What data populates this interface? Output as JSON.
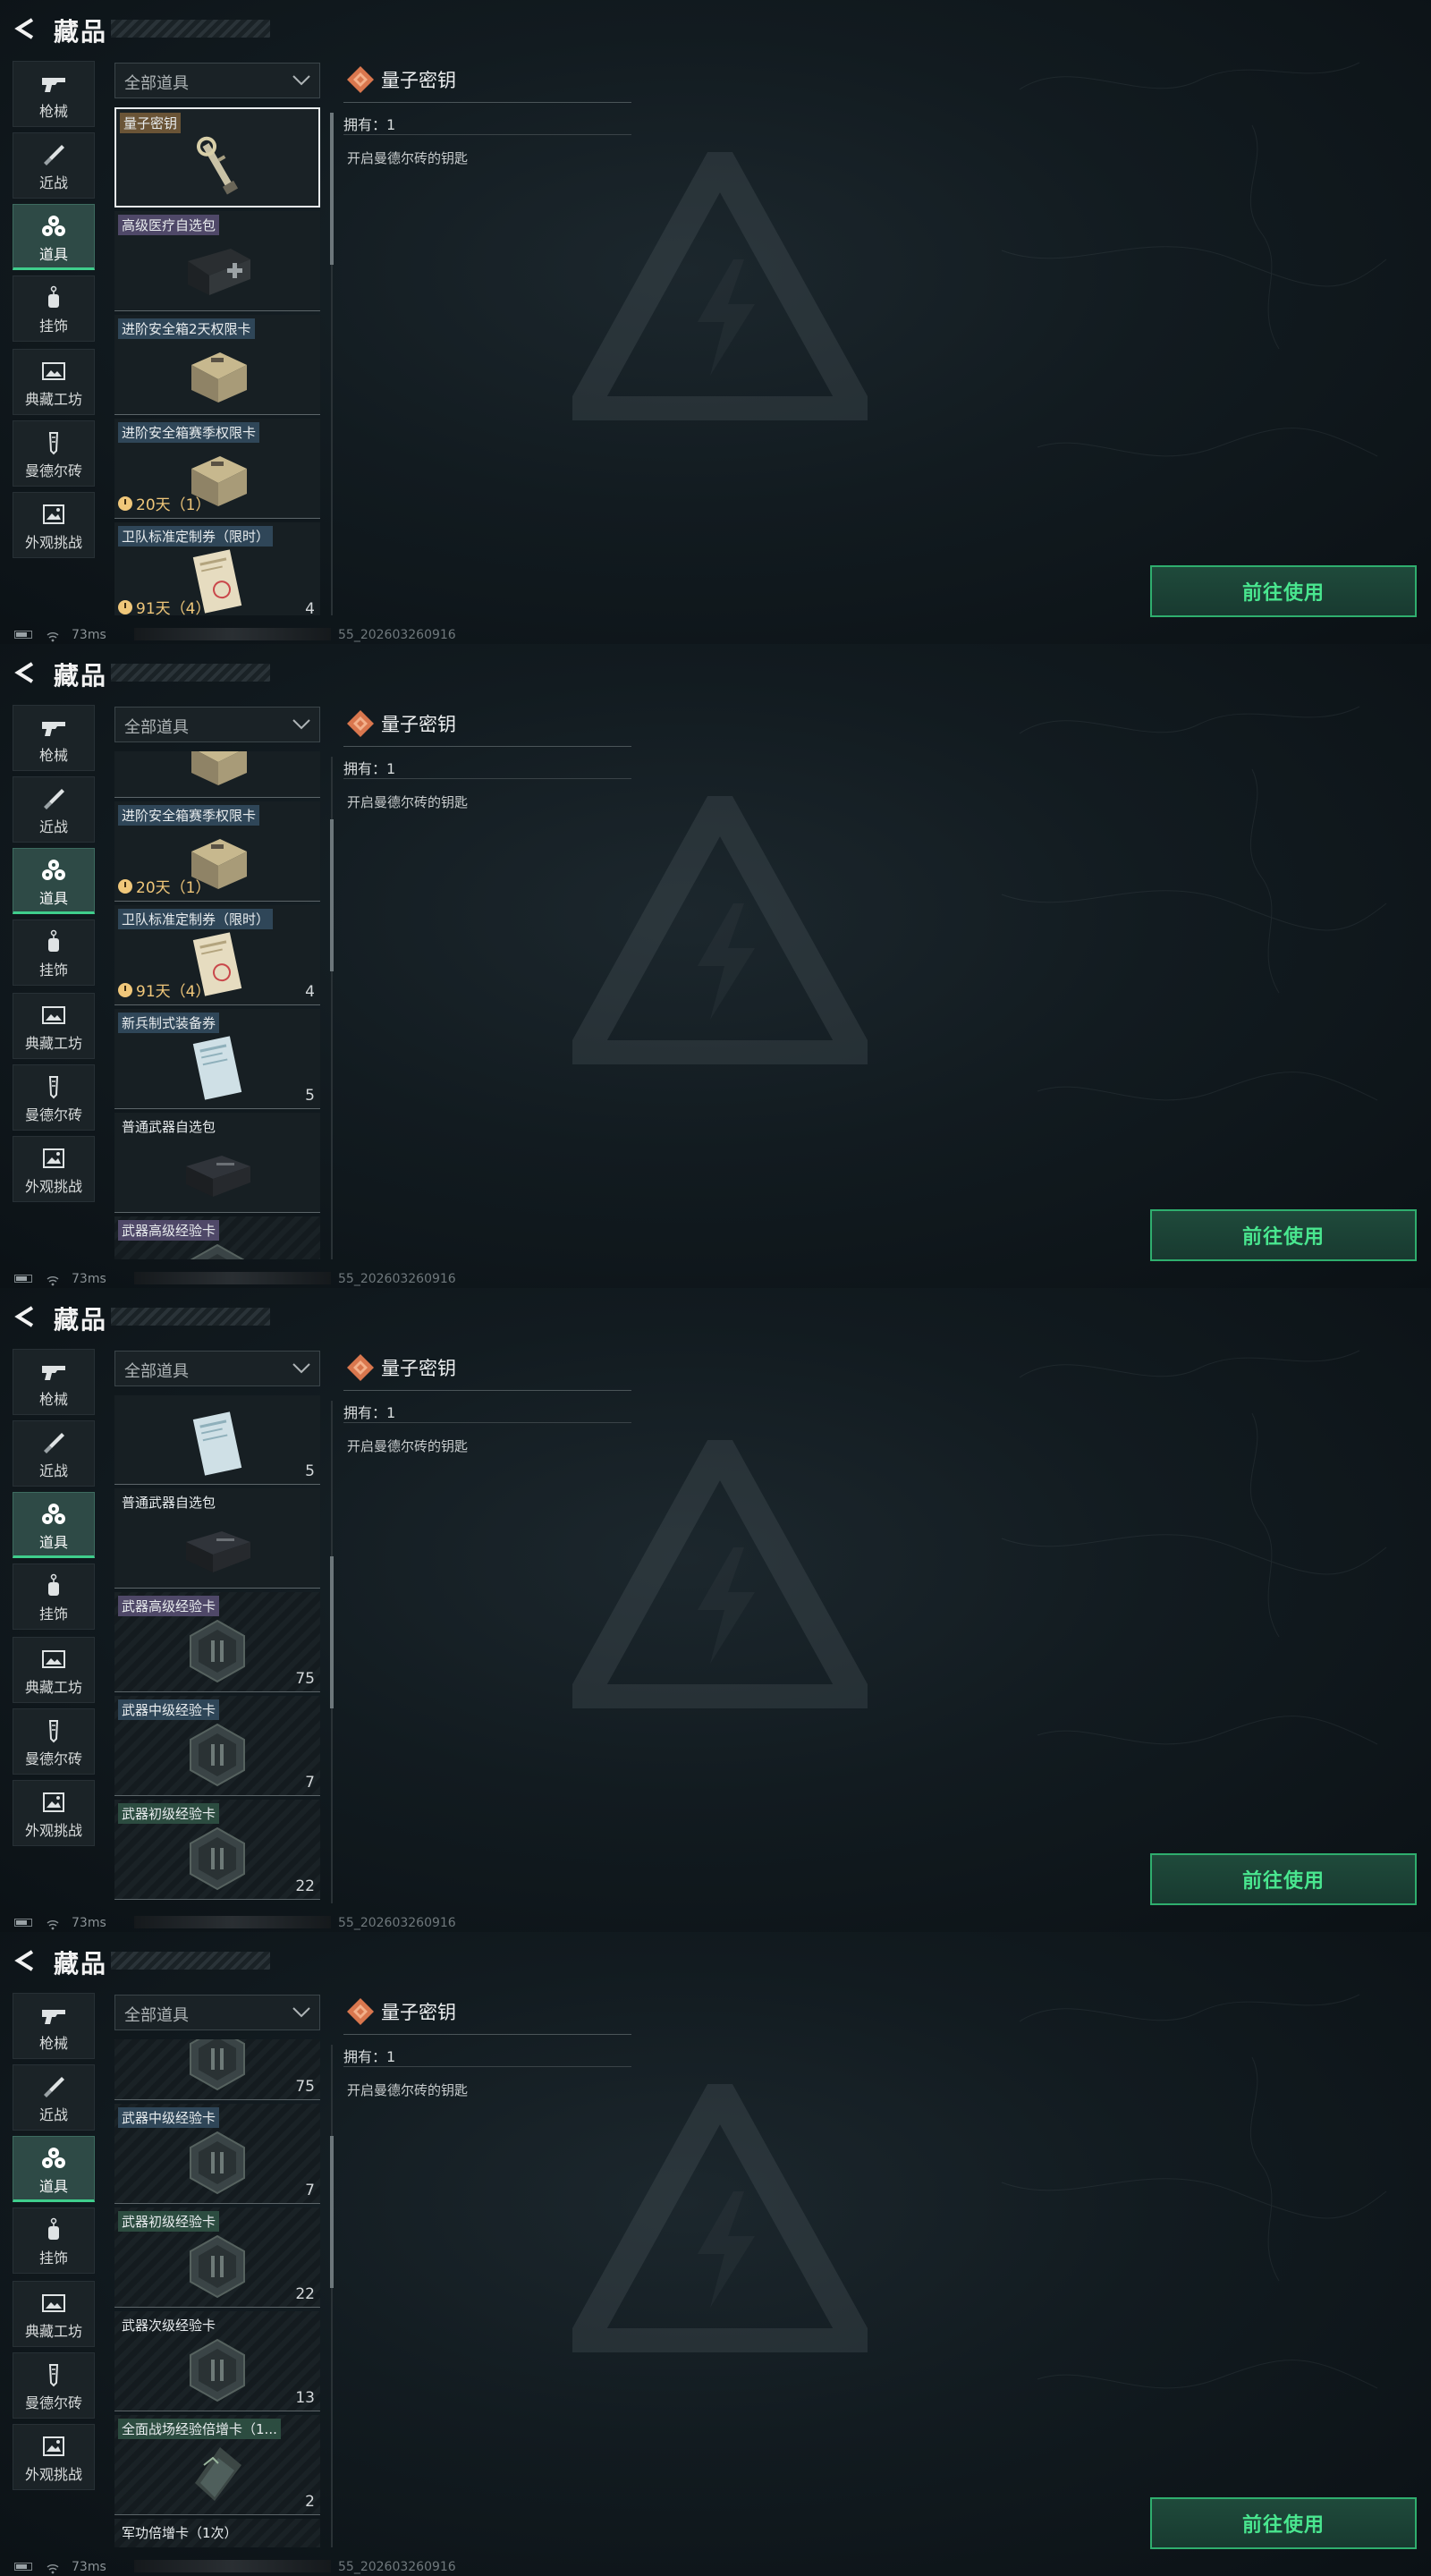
{
  "screens": [
    {
      "header": {
        "title": "藏品"
      },
      "sidebar": [
        {
          "label": "枪械",
          "icon": "gun-icon"
        },
        {
          "label": "近战",
          "icon": "knife-icon"
        },
        {
          "label": "道具",
          "icon": "items-icon"
        },
        {
          "label": "挂饰",
          "icon": "charm-icon"
        },
        {
          "label": "典藏工坊",
          "icon": "workshop-icon"
        },
        {
          "label": "曼德尔砖",
          "icon": "brick-icon"
        },
        {
          "label": "外观挑战",
          "icon": "challenge-icon"
        }
      ],
      "active_category": "道具",
      "dropdown": {
        "selected": "全部道具"
      },
      "list": [
        {
          "name": "量子密钥",
          "count": "",
          "timer": "",
          "quality": "gold",
          "thumb": "key",
          "selected": true
        },
        {
          "name": "高级医疗自选包",
          "count": "",
          "timer": "",
          "quality": "purple",
          "thumb": "medkit"
        },
        {
          "name": "进阶安全箱2天权限卡",
          "count": "",
          "timer": "",
          "quality": "blue",
          "thumb": "case"
        },
        {
          "name": "进阶安全箱赛季权限卡",
          "count": "",
          "timer": "20天（1）",
          "quality": "blue",
          "thumb": "case"
        },
        {
          "name": "卫队标准定制券（限时）",
          "count": "4",
          "timer": "91天（4）",
          "quality": "blue",
          "thumb": "coupon"
        }
      ],
      "detail": {
        "title": "量子密钥",
        "owned": "拥有：1",
        "description": "开启曼德尔砖的钥匙"
      },
      "use_button": "前往使用",
      "status": {
        "ping": "73ms",
        "build": "55_202603260916"
      }
    },
    {
      "header": {
        "title": "藏品"
      },
      "sidebar": [
        {
          "label": "枪械",
          "icon": "gun-icon"
        },
        {
          "label": "近战",
          "icon": "knife-icon"
        },
        {
          "label": "道具",
          "icon": "items-icon"
        },
        {
          "label": "挂饰",
          "icon": "charm-icon"
        },
        {
          "label": "典藏工坊",
          "icon": "workshop-icon"
        },
        {
          "label": "曼德尔砖",
          "icon": "brick-icon"
        },
        {
          "label": "外观挑战",
          "icon": "challenge-icon"
        }
      ],
      "active_category": "道具",
      "dropdown": {
        "selected": "全部道具"
      },
      "list": [
        {
          "name": "",
          "count": "",
          "timer": "",
          "quality": "gray",
          "thumb": "case"
        },
        {
          "name": "进阶安全箱赛季权限卡",
          "count": "",
          "timer": "20天（1）",
          "quality": "blue",
          "thumb": "case"
        },
        {
          "name": "卫队标准定制券（限时）",
          "count": "4",
          "timer": "91天（4）",
          "quality": "blue",
          "thumb": "coupon"
        },
        {
          "name": "新兵制式装备券",
          "count": "5",
          "timer": "",
          "quality": "blue",
          "thumb": "coupon-blue"
        },
        {
          "name": "普通武器自选包",
          "count": "",
          "timer": "",
          "quality": "gray",
          "thumb": "weaponbox"
        },
        {
          "name": "武器高级经验卡",
          "count": "",
          "timer": "",
          "quality": "purple",
          "thumb": "expcard",
          "striped": true
        }
      ],
      "detail": {
        "title": "量子密钥",
        "owned": "拥有：1",
        "description": "开启曼德尔砖的钥匙"
      },
      "use_button": "前往使用",
      "status": {
        "ping": "73ms",
        "build": "55_202603260916"
      }
    },
    {
      "header": {
        "title": "藏品"
      },
      "sidebar": [
        {
          "label": "枪械",
          "icon": "gun-icon"
        },
        {
          "label": "近战",
          "icon": "knife-icon"
        },
        {
          "label": "道具",
          "icon": "items-icon"
        },
        {
          "label": "挂饰",
          "icon": "charm-icon"
        },
        {
          "label": "典藏工坊",
          "icon": "workshop-icon"
        },
        {
          "label": "曼德尔砖",
          "icon": "brick-icon"
        },
        {
          "label": "外观挑战",
          "icon": "challenge-icon"
        }
      ],
      "active_category": "道具",
      "dropdown": {
        "selected": "全部道具"
      },
      "list": [
        {
          "name": "",
          "count": "5",
          "timer": "",
          "quality": "gray",
          "thumb": "coupon-blue"
        },
        {
          "name": "普通武器自选包",
          "count": "",
          "timer": "",
          "quality": "gray",
          "thumb": "weaponbox"
        },
        {
          "name": "武器高级经验卡",
          "count": "75",
          "timer": "",
          "quality": "purple",
          "thumb": "expcard",
          "striped": true
        },
        {
          "name": "武器中级经验卡",
          "count": "7",
          "timer": "",
          "quality": "blue",
          "thumb": "expcard",
          "striped": true
        },
        {
          "name": "武器初级经验卡",
          "count": "22",
          "timer": "",
          "quality": "green",
          "thumb": "expcard",
          "striped": true
        }
      ],
      "detail": {
        "title": "量子密钥",
        "owned": "拥有：1",
        "description": "开启曼德尔砖的钥匙"
      },
      "use_button": "前往使用",
      "status": {
        "ping": "73ms",
        "build": "55_202603260916"
      }
    },
    {
      "header": {
        "title": "藏品"
      },
      "sidebar": [
        {
          "label": "枪械",
          "icon": "gun-icon"
        },
        {
          "label": "近战",
          "icon": "knife-icon"
        },
        {
          "label": "道具",
          "icon": "items-icon"
        },
        {
          "label": "挂饰",
          "icon": "charm-icon"
        },
        {
          "label": "典藏工坊",
          "icon": "workshop-icon"
        },
        {
          "label": "曼德尔砖",
          "icon": "brick-icon"
        },
        {
          "label": "外观挑战",
          "icon": "challenge-icon"
        }
      ],
      "active_category": "道具",
      "dropdown": {
        "selected": "全部道具"
      },
      "list": [
        {
          "name": "",
          "count": "75",
          "timer": "",
          "quality": "gray",
          "thumb": "expcard",
          "striped": true
        },
        {
          "name": "武器中级经验卡",
          "count": "7",
          "timer": "",
          "quality": "blue",
          "thumb": "expcard",
          "striped": true
        },
        {
          "name": "武器初级经验卡",
          "count": "22",
          "timer": "",
          "quality": "green",
          "thumb": "expcard",
          "striped": true
        },
        {
          "name": "武器次级经验卡",
          "count": "13",
          "timer": "",
          "quality": "gray",
          "thumb": "expcard",
          "striped": true
        },
        {
          "name": "全面战场经验倍增卡（1...",
          "count": "2",
          "timer": "",
          "quality": "green",
          "thumb": "multicard",
          "striped": true
        },
        {
          "name": "军功倍增卡（1次）",
          "count": "",
          "timer": "",
          "quality": "gray",
          "thumb": "multicard",
          "striped": true
        }
      ],
      "detail": {
        "title": "量子密钥",
        "owned": "拥有：1",
        "description": "开启曼德尔砖的钥匙"
      },
      "use_button": "前往使用",
      "status": {
        "ping": "73ms",
        "build": "55_202603260916"
      }
    }
  ]
}
